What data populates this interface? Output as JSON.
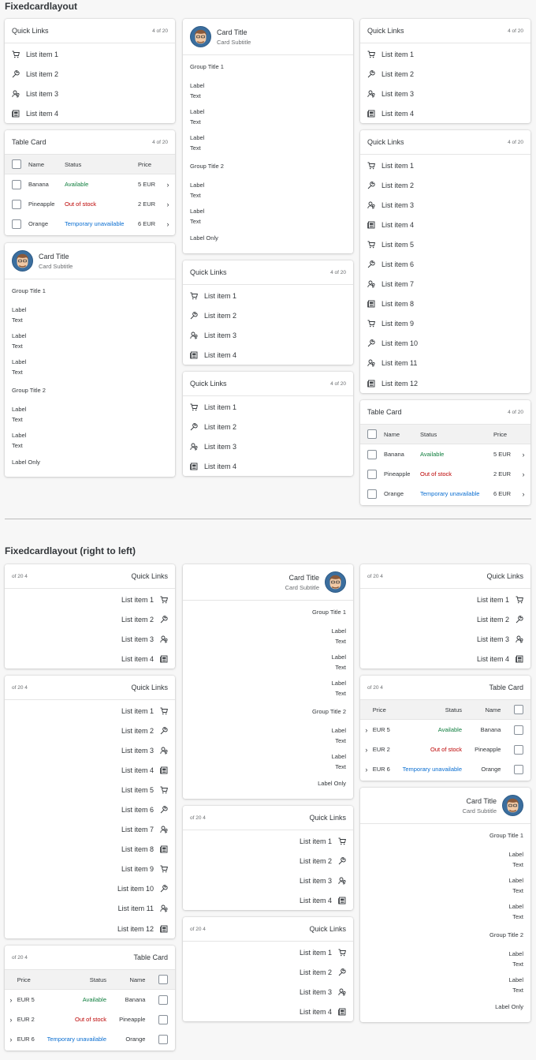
{
  "sections": {
    "ltr_title": "Fixedcardlayout",
    "rtl_title": "Fixedcardlayout (right to left)"
  },
  "colors": {
    "green": "#107e3e",
    "red": "#bb0000",
    "blue": "#0a6ed1"
  },
  "ql": {
    "title": "Quick Links",
    "count": "4 of 20",
    "count_rtl": "of 20 4",
    "items": [
      "List item 1",
      "List item 2",
      "List item 3",
      "List item 4",
      "List item 5",
      "List item 6",
      "List item 7",
      "List item 8",
      "List item 9",
      "List item 10",
      "List item 11",
      "List item 12"
    ],
    "icons": [
      "cart-icon",
      "wrench-icon",
      "people-icon",
      "news-icon"
    ]
  },
  "table": {
    "title": "Table Card",
    "count": "4 of 20",
    "count_rtl": "of 20 4",
    "headers": {
      "name": "Name",
      "status": "Status",
      "price": "Price"
    },
    "rows": [
      {
        "name": "Banana",
        "status": "Available",
        "price": "5 EUR",
        "price_rtl": "EUR 5",
        "status_type": "green"
      },
      {
        "name": "Pineapple",
        "status": "Out of stock",
        "price": "2 EUR",
        "price_rtl": "EUR 2",
        "status_type": "red"
      },
      {
        "name": "Orange",
        "status": "Temporary unavailable",
        "price": "6 EUR",
        "price_rtl": "EUR 6",
        "status_type": "blue"
      }
    ]
  },
  "object": {
    "title": "Card Title",
    "subtitle": "Card Subtitle",
    "group1": "Group Title 1",
    "group2": "Group Title 2",
    "label": "Label",
    "text": "Text",
    "label_only": "Label Only"
  }
}
